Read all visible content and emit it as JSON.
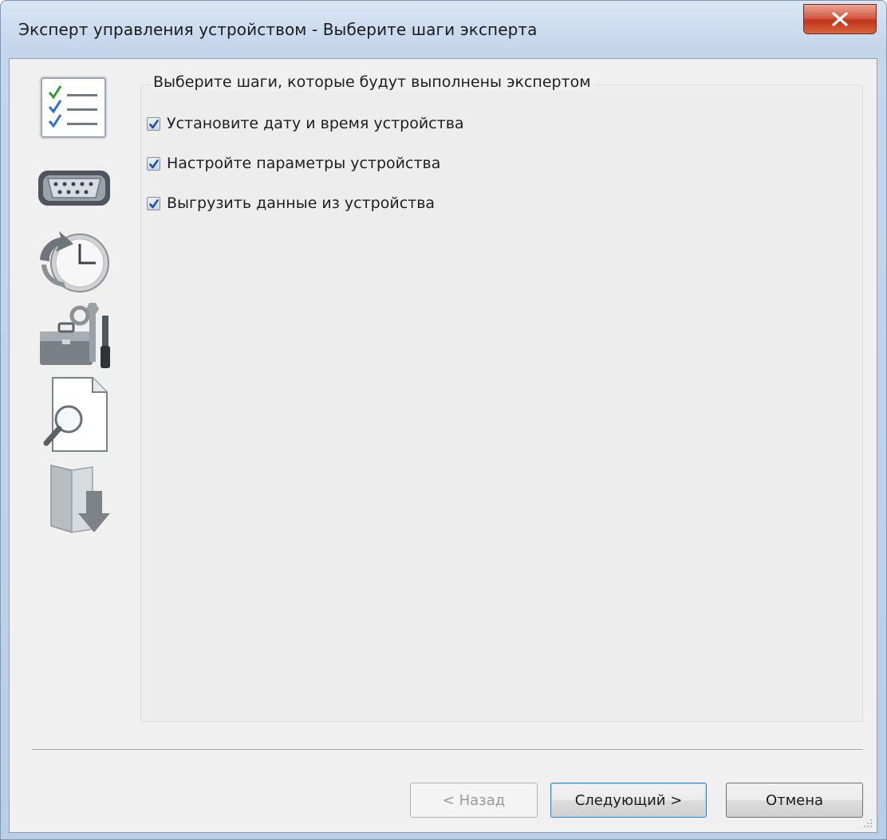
{
  "window": {
    "title": "Эксперт управления устройством - Выберите шаги эксперта"
  },
  "step_icons": [
    "checklist-icon",
    "serial-port-icon",
    "clock-sync-icon",
    "toolbox-icon",
    "document-search-icon",
    "download-folder-icon"
  ],
  "group": {
    "label": "Выберите шаги, которые будут выполнены экспертом"
  },
  "steps": [
    {
      "label": "Установите дату и время устройства",
      "checked": true
    },
    {
      "label": "Настройте параметры устройства",
      "checked": true
    },
    {
      "label": "Выгрузить данные из устройства",
      "checked": true
    }
  ],
  "buttons": {
    "back_label": "< Назад",
    "next_label": "Следующий >",
    "cancel_label": "Отмена"
  },
  "colors": {
    "close_button": "#c0351c",
    "check_mark": "#1f4fa8",
    "dialog_background": "#f0f0f0"
  }
}
